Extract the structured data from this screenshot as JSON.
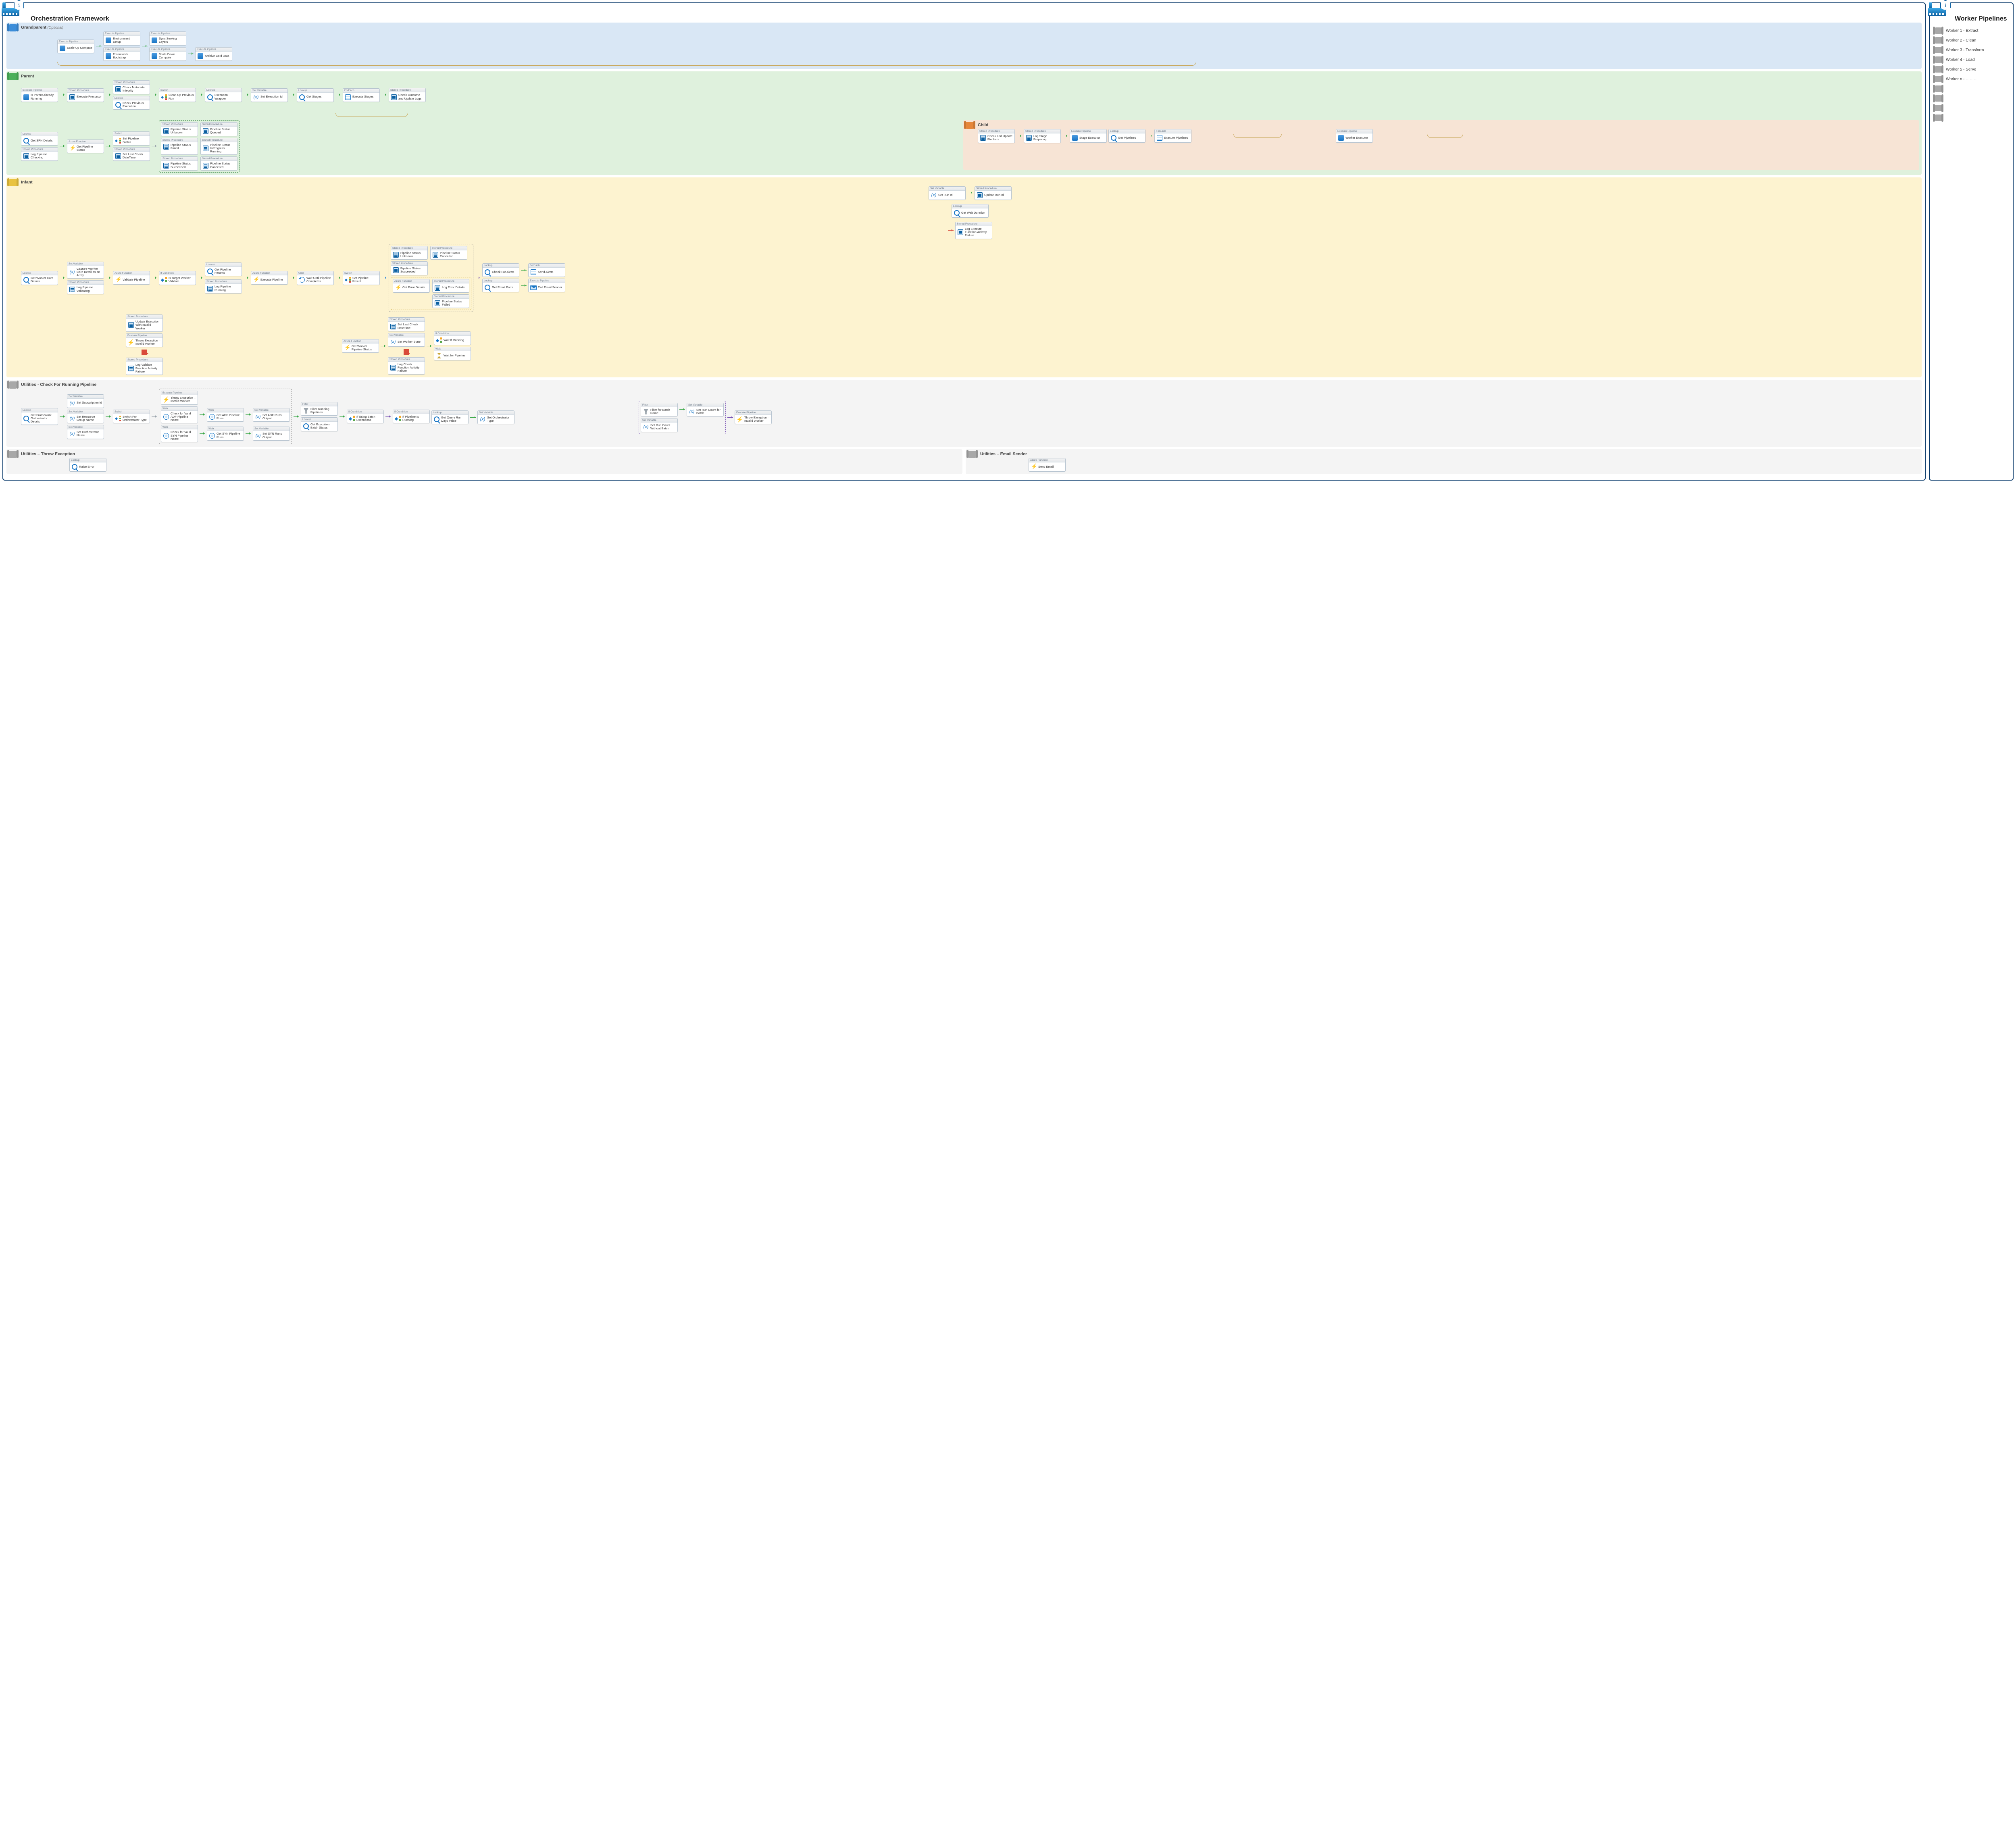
{
  "titles": {
    "main": "Orchestration Framework",
    "side": "Worker Pipelines"
  },
  "sections": {
    "grandparent": {
      "label": "Grandparent",
      "sub": "(Optional)"
    },
    "parent": {
      "label": "Parent"
    },
    "child": {
      "label": "Child"
    },
    "infant": {
      "label": "Infant"
    },
    "util_check": {
      "label": "Utilities - Check For Running Pipeline"
    },
    "util_throw": {
      "label": "Utilities – Throw Exception"
    },
    "util_email": {
      "label": "Utilities – Email Sender"
    }
  },
  "activities": {
    "grandparent": {
      "scaleUp": "Scale Up Compute",
      "envSetup": "Environment Setup",
      "bootstrap": "Framework Bootstrap",
      "sync": "Sync Serving Layers",
      "scaleDown": "Scale Down Compute",
      "archive": "Archive Cold Data"
    },
    "parent": {
      "isRunning": "Is Parent Already Running",
      "execPrecursor": "Execute Precursor",
      "checkMeta": "Check Metadata Integrity",
      "checkPrev": "Check Previous Execution",
      "cleanup": "Clean Up Previous Run",
      "execWrapper": "Execution Wrapper",
      "setExecId": "Set Execution Id",
      "getStages": "Get Stages",
      "execStages": "Execute Stages",
      "checkOutcome": "Check Outcome and Update Logs",
      "getSPN": "Get SPN Details",
      "logChecking": "Log Pipeline Checking",
      "getPipeStatus": "Get Pipeline Status",
      "setPipeStatus": "Set Pipeline Status",
      "setLastCheck": "Set Last Check DateTime",
      "psUnknown": "Pipeline Status Unknown",
      "psQueued": "Pipeline Status Queued",
      "psFailed": "Pipeline Status Failed",
      "psInProgress": "Pipeline Status InProgress Running",
      "psSucceeded": "Pipeline Status Succeeded",
      "psCancelled": "Pipeline Status Cancelled",
      "checkBlockers": "Check and Update Blockers",
      "logStagePrep": "Log Stage Preparing",
      "stageExecutor": "Stage Executor"
    },
    "child": {
      "getPipelines": "Get Pipelines",
      "execPipelines": "Execute Pipelines",
      "workerExecutor": "Worker Executor"
    },
    "infant": {
      "getWorkerCore": "Get Worker Core Details",
      "captureArray": "Capture Worker Core Detail as an Array",
      "logValidating": "Log Pipeline Validating",
      "validatePipe": "Validate Pipeline",
      "isTargetValid": "Is Target Worker Validate",
      "updateInvalid": "Update Execution With Invalid Worker",
      "throwInvalid": "Throw Exception – Invalid Worker",
      "logValidateFail": "Log Validate Function Activity Failure",
      "logRunning": "Log Pipeline Running",
      "getParams": "Get Pipeline Params",
      "executePipe": "Execute Pipeline",
      "setRunId": "Set Run Id",
      "updateRunId": "Update Run Id",
      "getWaitDur": "Get Wait Duration",
      "logExecFail": "Log Execute Function Activity Failure",
      "getWorkerStatus": "Get Worker Pipeline Status",
      "setLastCheck2": "Set Last Check DateTime",
      "setWorkerState": "Set Worker State",
      "logCheckFail": "Log Check Function Activity Failure",
      "waitIfRunning": "Wait If Running",
      "waitForPipe": "Wait for Pipeline",
      "waitUntil": "Wait Until Pipeline Completes",
      "setResult": "Set Pipeline Result",
      "ps2Unknown": "Pipeline Status Unknown",
      "ps2Cancelled": "Pipeline Status Cancelled",
      "ps2Succeeded": "Pipeline Status Succeeded",
      "getErrDetails": "Get Error Details",
      "logErrDetails": "Log Error Details",
      "ps2Failed": "Pipeline Status Failed",
      "checkAlerts": "Check For Alerts",
      "sendAlerts": "Send Alerts",
      "getEmailParts": "Get Email Parts",
      "callEmail": "Call Email Sender"
    },
    "utilCheck": {
      "getOrchDetails": "Get Framework Orchestrator Details",
      "setSubId": "Set Subscription Id",
      "setRGName": "Set Resource Group Name",
      "setOrchName": "Set Orchestrator Name",
      "getQueryDays": "Get Query Run Days Value",
      "setOrchType": "Set Orchestrator Type",
      "switchOrch": "Switch For Orchestrator Type",
      "throwInvalid2": "Throw Exception – Invalid Worker",
      "checkADFName": "Check for Valid ADF Pipeline Name",
      "getADFRuns": "Get ADF Pipeline Runs",
      "setADFOut": "Set ADF Runs Output",
      "checkSYNName": "Check for Valid SYN Pipeline Name",
      "getSYNRuns": "Get SYN Pipeline Runs",
      "setSYNOut": "Set SYN Runs Output",
      "filterRunning": "Filter Running Pipelines",
      "getExecBatch": "Get Execution Batch Status",
      "ifBatch": "If Using Batch Executions",
      "filterBatch": "Filter for Batch Name",
      "setCountBatch": "Set Run Count for Batch",
      "setCountNoBatch": "Set Run Count Without Batch",
      "ifRunning": "If Pipeline Is Running",
      "throwInvalid3": "Throw Exception – Invalid Worker"
    },
    "utilThrow": {
      "raise": "Raise Error"
    },
    "utilEmail": {
      "send": "Send Email"
    }
  },
  "heads": {
    "storedProc": "Stored Procedure",
    "lookup": "Lookup",
    "setVar": "Set Variable",
    "ifCond": "If Condition",
    "switch": "Switch",
    "execPipe": "Execute Pipeline",
    "forEach": "ForEach",
    "wait": "Wait",
    "until": "Until",
    "web": "Web",
    "filter": "Filter",
    "azFn": "Azure Function"
  },
  "workers": [
    "Worker 1 - Extract",
    "Worker 2 - Clean",
    "Worker 3 - Transform",
    "Worker 4 - Load",
    "Worker 5 - Serve",
    "Worker n - ………"
  ]
}
